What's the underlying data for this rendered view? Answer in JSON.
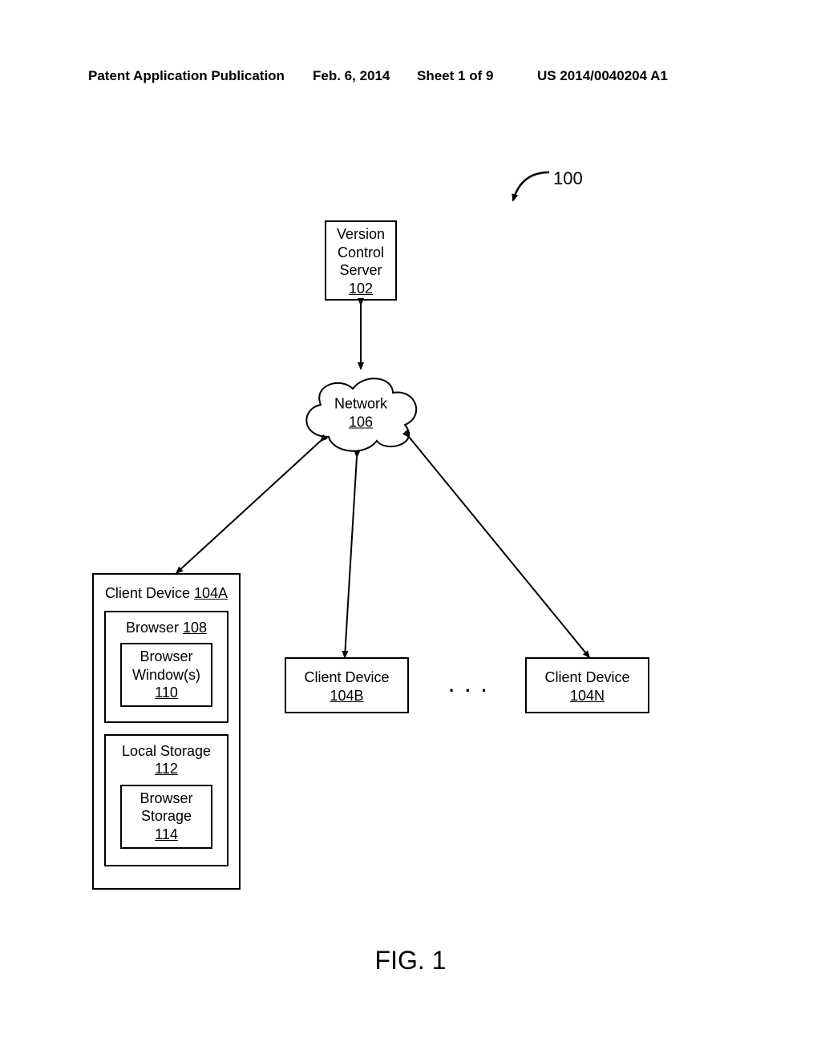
{
  "header": {
    "publication": "Patent Application Publication",
    "date": "Feb. 6, 2014",
    "sheet": "Sheet 1 of 9",
    "pubno": "US 2014/0040204 A1"
  },
  "figure": {
    "ref": "100",
    "caption": "FIG. 1",
    "blocks": {
      "vcs": {
        "name": "Version Control Server",
        "num": "102"
      },
      "network": {
        "name": "Network",
        "num": "106"
      },
      "clientA": {
        "title_name": "Client Device",
        "title_num": "104A",
        "browser": {
          "name": "Browser",
          "num": "108"
        },
        "browser_window": {
          "name": "Browser Window(s)",
          "num": "110"
        },
        "local_storage": {
          "name": "Local Storage",
          "num": "112"
        },
        "browser_storage": {
          "name": "Browser Storage",
          "num": "114"
        }
      },
      "clientB": {
        "name": "Client Device",
        "num": "104B"
      },
      "clientN": {
        "name": "Client Device",
        "num": "104N"
      },
      "ellipsis": ". . ."
    }
  }
}
